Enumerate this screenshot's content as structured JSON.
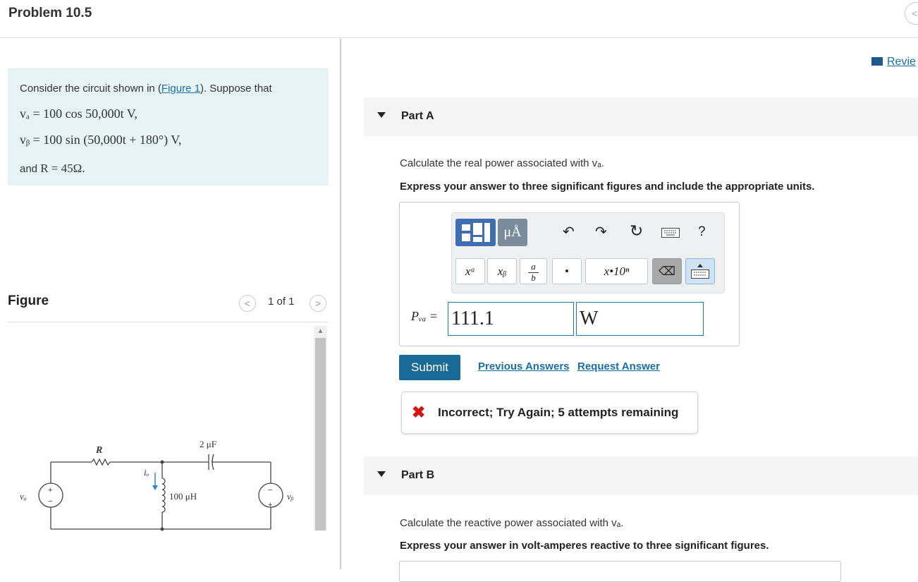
{
  "header": {
    "title": "Problem 10.5",
    "prev_glyph": "<"
  },
  "review": {
    "label": "Revie"
  },
  "problem": {
    "intro_prefix": "Consider the circuit shown in (",
    "figure_link": "Figure 1",
    "intro_suffix": "). Suppose that",
    "va_eq": "vₐ = 100 cos 50,000t V,",
    "vb_eq": "vᵦ = 100 sin (50,000t + 180°) V,",
    "r_prefix": "and ",
    "r_eq": "R = 45Ω."
  },
  "figure": {
    "heading": "Figure",
    "pager": "1 of 1",
    "prev": "<",
    "next": ">",
    "labels": {
      "r": "R",
      "cap": "2 μF",
      "io": "iₒ",
      "ind": "100 μH",
      "va": "vₐ",
      "vb": "vᵦ",
      "plus": "+",
      "minus": "−"
    }
  },
  "partA": {
    "label": "Part A",
    "question": "Calculate the real power associated with vₐ.",
    "instruction": "Express your answer to three significant figures and include the appropriate units.",
    "toolbar": {
      "mu": "μÅ",
      "undo": "↶",
      "redo": "↷",
      "reset": "↻",
      "help": "?",
      "sup": "xᵃ",
      "sub": "xᵦ",
      "frac_a": "a",
      "frac_b": "b",
      "dot": "•",
      "sci": "x•10ⁿ",
      "backspace": "⌫"
    },
    "variable": "Pᵥₐ =",
    "value": "111.1",
    "unit": "W",
    "submit": "Submit",
    "previous_answers": "Previous Answers",
    "request_answer": "Request Answer",
    "feedback_icon": "✖",
    "feedback": "Incorrect; Try Again; 5 attempts remaining"
  },
  "partB": {
    "label": "Part B",
    "question": "Calculate the reactive power associated with vₐ.",
    "instruction": "Express your answer in volt-amperes reactive to three significant figures."
  },
  "colors": {
    "accent": "#1a6a98",
    "error": "#d21515",
    "problem_bg": "#e7f4f6",
    "link": "#1a6ea6"
  }
}
